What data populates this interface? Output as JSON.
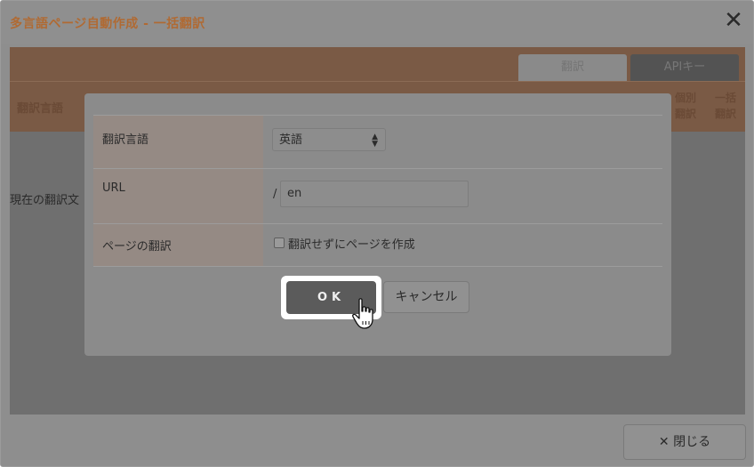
{
  "window": {
    "title": "多言語ページ自動作成 - 一括翻訳",
    "close_glyph": "✕"
  },
  "background": {
    "tabs": [
      "翻訳",
      "APIキー"
    ],
    "header_label": "翻訳言語",
    "col_individual": [
      "個別",
      "翻訳"
    ],
    "col_bulk": [
      "一括",
      "翻訳"
    ],
    "body_text": "現在の翻訳文"
  },
  "modal": {
    "fields": [
      {
        "label": "翻訳言語",
        "select_value": "英語"
      },
      {
        "label": "URL",
        "prefix": "/",
        "input_value": "en"
      },
      {
        "label": "ページの翻訳",
        "checkbox_label": "翻訳せずにページを作成",
        "checked": false
      }
    ],
    "ok_label": "OK",
    "cancel_label": "キャンセル"
  },
  "footer": {
    "close_label": "✕ 閉じる"
  },
  "colors": {
    "title_color": "#b06a33",
    "overlay_gray": "#8e8e8e",
    "header_brown": "#7a5a45"
  },
  "icons": {
    "select_arrow": "up-down-arrows-icon",
    "cursor": "hand-pointer-icon"
  }
}
